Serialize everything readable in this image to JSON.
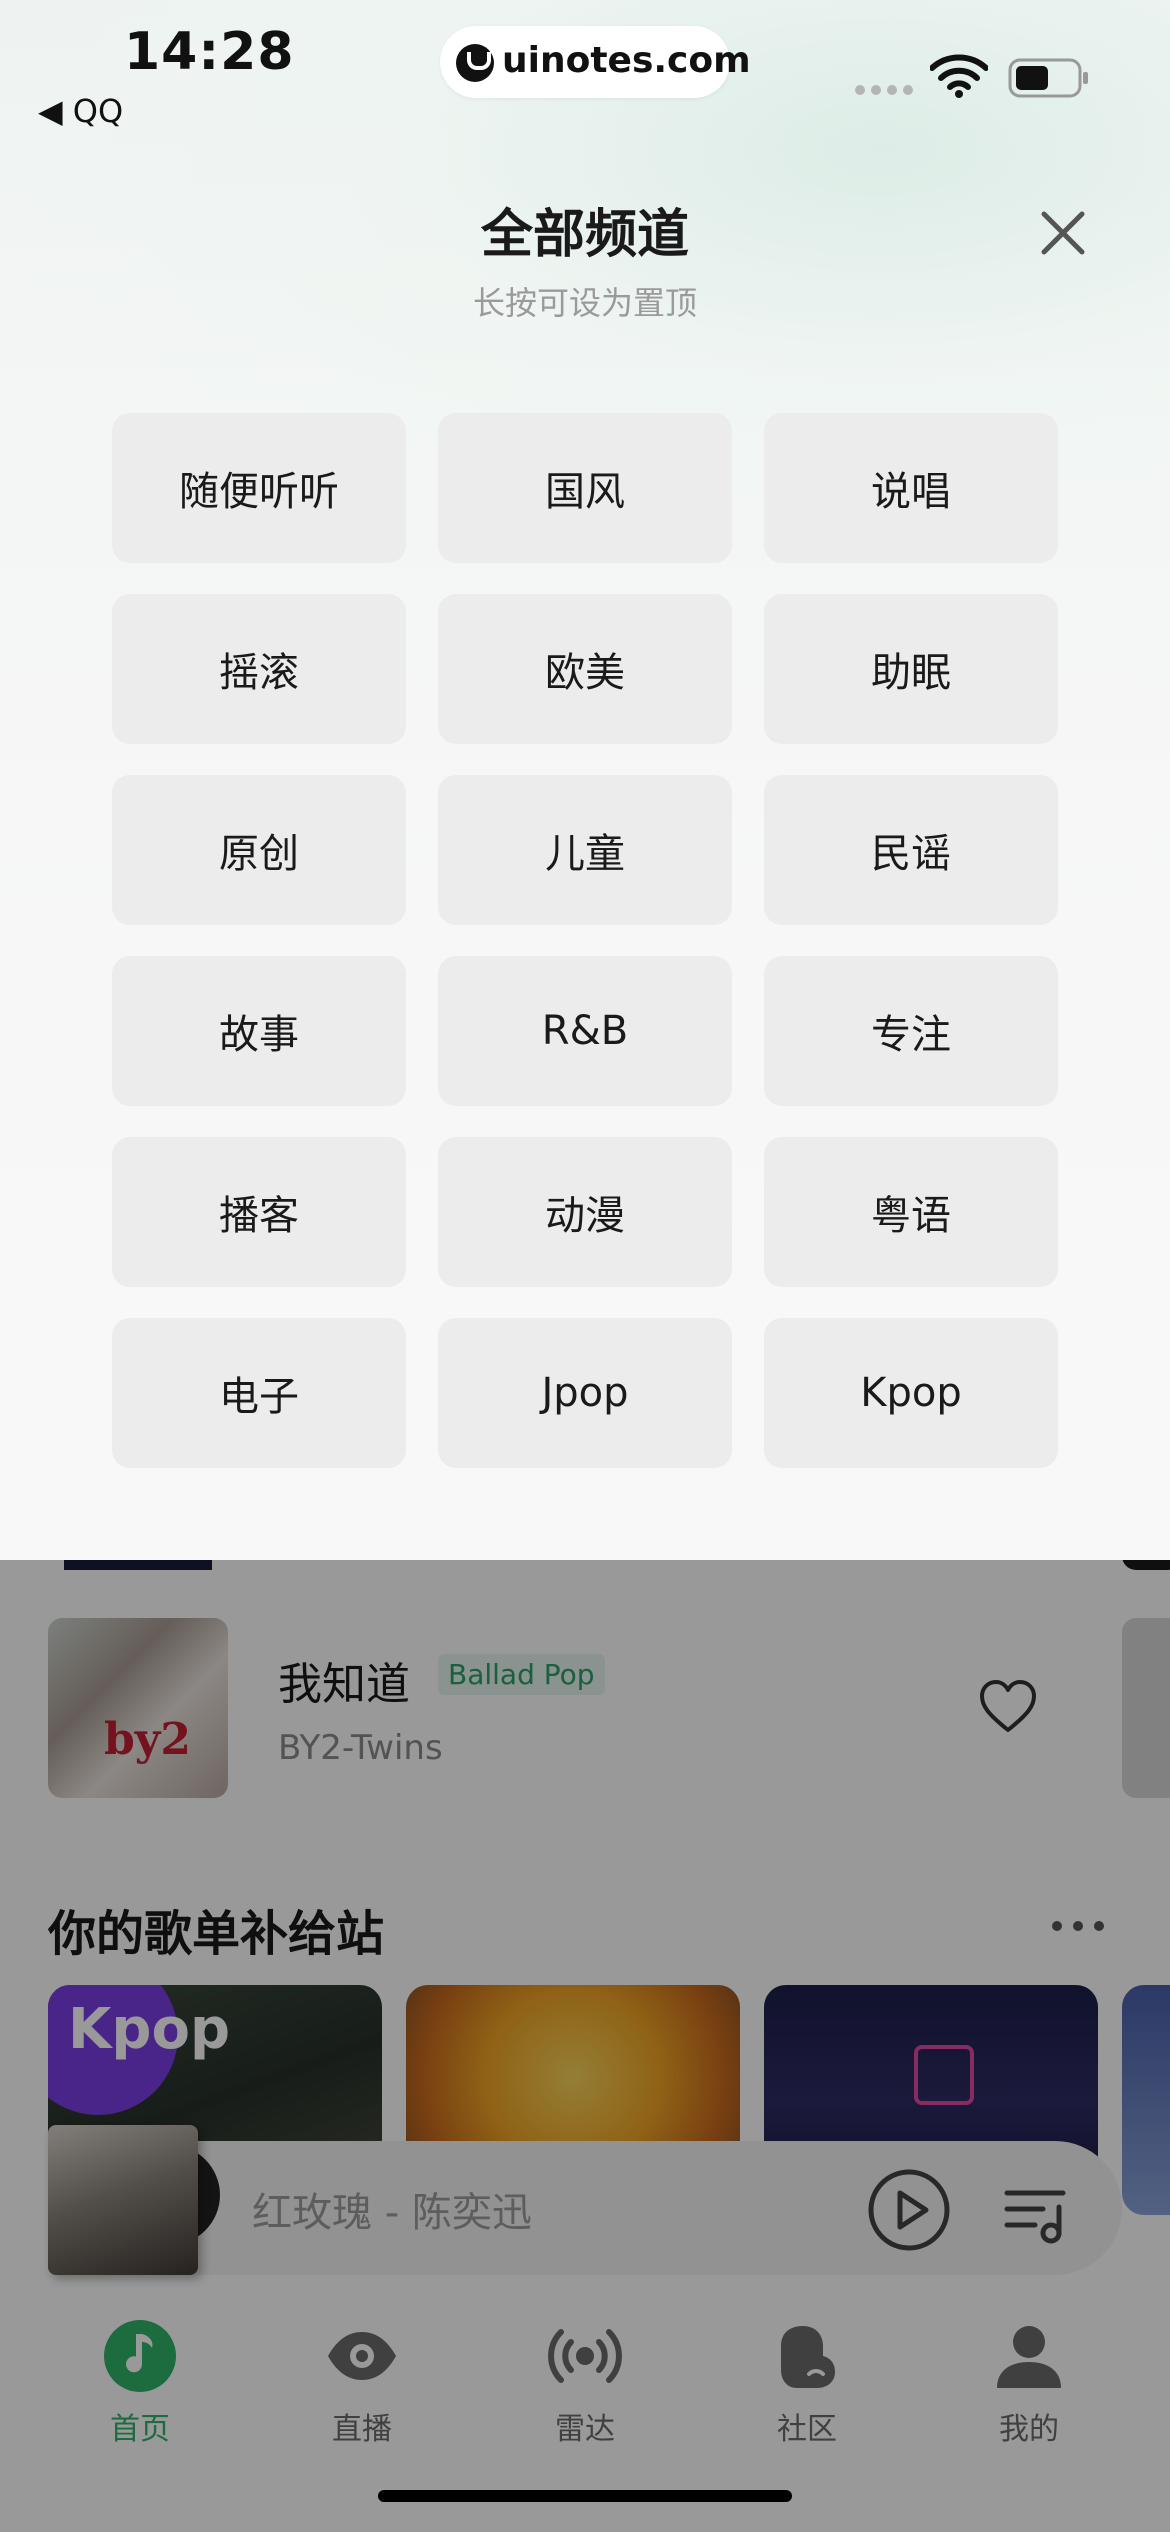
{
  "status_bar": {
    "time": "14:28",
    "back_app": "◀ QQ",
    "url": "uinotes.com"
  },
  "sheet": {
    "title": "全部频道",
    "subtitle": "长按可设为置顶",
    "channels": [
      "随便听听",
      "国风",
      "说唱",
      "摇滚",
      "欧美",
      "助眠",
      "原创",
      "儿童",
      "民谣",
      "故事",
      "R&B",
      "专注",
      "播客",
      "动漫",
      "粤语",
      "电子",
      "Jpop",
      "Kpop"
    ]
  },
  "song": {
    "title": "我知道",
    "tag": "Ballad Pop",
    "artist": "BY2-Twins",
    "cover_text": "by2"
  },
  "playlist_section": {
    "title": "你的歌单补给站",
    "first_card_label": "Kpop"
  },
  "mini_player": {
    "title": "红玫瑰 - 陈奕迅"
  },
  "tabs": [
    {
      "label": "首页",
      "icon": "music-note-icon",
      "active": true
    },
    {
      "label": "直播",
      "icon": "eye-icon",
      "active": false
    },
    {
      "label": "雷达",
      "icon": "radar-icon",
      "active": false
    },
    {
      "label": "社区",
      "icon": "community-icon",
      "active": false
    },
    {
      "label": "我的",
      "icon": "profile-icon",
      "active": false
    }
  ],
  "colors": {
    "accent": "#2fb46a",
    "chip_bg": "#ececec",
    "dim_overlay": "rgba(0,0,0,0.40)"
  }
}
